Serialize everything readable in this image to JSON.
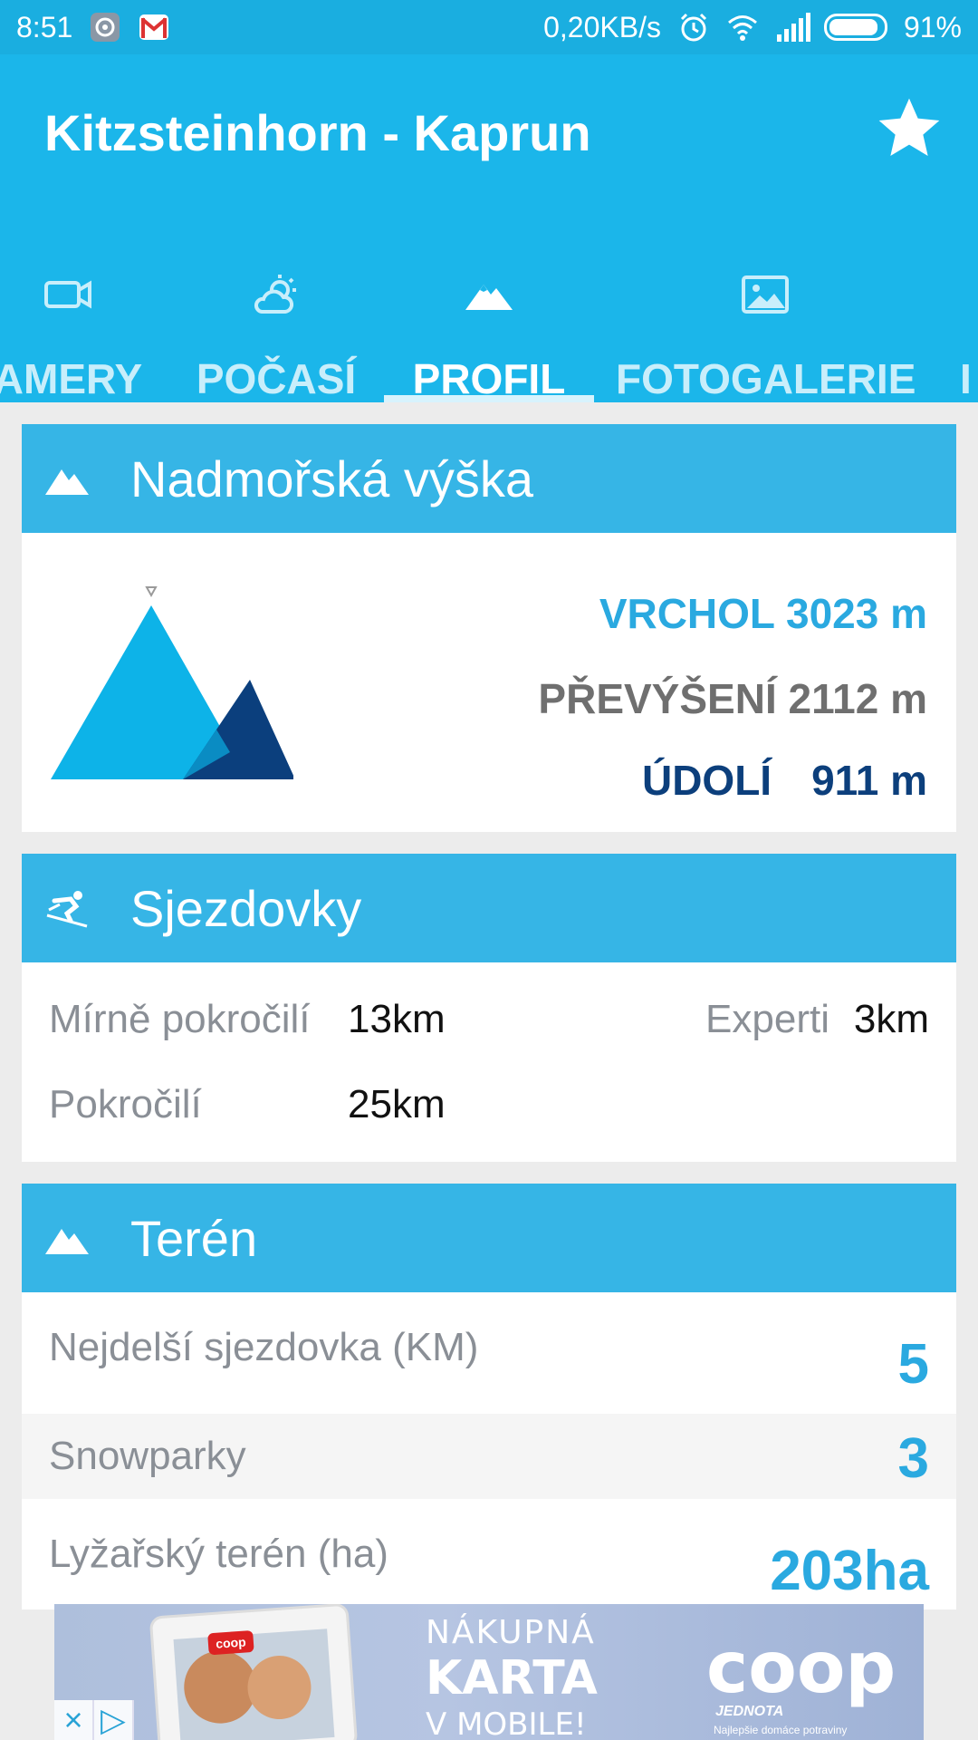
{
  "status_bar": {
    "time": "8:51",
    "speed": "0,20KB/s",
    "battery_percent": "91%",
    "battery_level": 0.91,
    "notification_icons": [
      "settings-app-icon",
      "gmail-icon"
    ],
    "system_icons": [
      "alarm-icon",
      "wifi-icon",
      "signal-icon",
      "battery-icon"
    ]
  },
  "app_bar": {
    "title": "Kitzsteinhorn - Kaprun",
    "action_icon": "star-icon"
  },
  "tabs": [
    {
      "label": "AMERY",
      "icon": "video-camera-icon",
      "active": false
    },
    {
      "label": "POČASÍ",
      "icon": "weather-icon",
      "active": false
    },
    {
      "label": "PROFIL",
      "icon": "mountain-icon",
      "active": true
    },
    {
      "label": "FOTOGALERIE",
      "icon": "image-icon",
      "active": false
    },
    {
      "label": "I",
      "icon": "",
      "active": false
    }
  ],
  "altitude": {
    "header": "Nadmořská výška",
    "vrchol": "VRCHOL 3023 m",
    "prevyseni": "PŘEVÝŠENÍ 2112 m",
    "udoli_label": "ÚDOLÍ",
    "udoli_value": "911 m"
  },
  "pistes": {
    "header": "Sjezdovky",
    "items": [
      {
        "label": "Mírně pokročilí",
        "value": "13km"
      },
      {
        "label": "Experti",
        "value": "3km"
      },
      {
        "label": "Pokročilí",
        "value": "25km"
      }
    ]
  },
  "terrain": {
    "header": "Terén",
    "rows": [
      {
        "label": "Nejdelší sjezdovka (KM)",
        "value": "5"
      },
      {
        "label": "Snowparky",
        "value": "3"
      },
      {
        "label": "Lyžařský terén (ha)",
        "value": "203ha"
      }
    ]
  },
  "ad": {
    "line1": "NÁKUPNÁ",
    "line2": "KARTA",
    "line3": "V MOBILE!",
    "brand": "coop",
    "brand_sub": "JEDNOTA",
    "brand_tag": "Najlepšie domáce potraviny",
    "phone_logo": "coop",
    "close_glyph": "×",
    "adchoices_glyph": "▷"
  },
  "colors": {
    "primary": "#1bb6ea",
    "header": "#36b5e6",
    "accent_blue": "#2aa9e0",
    "dark_blue": "#0c3f7c",
    "gray_text": "#8a8f96"
  }
}
